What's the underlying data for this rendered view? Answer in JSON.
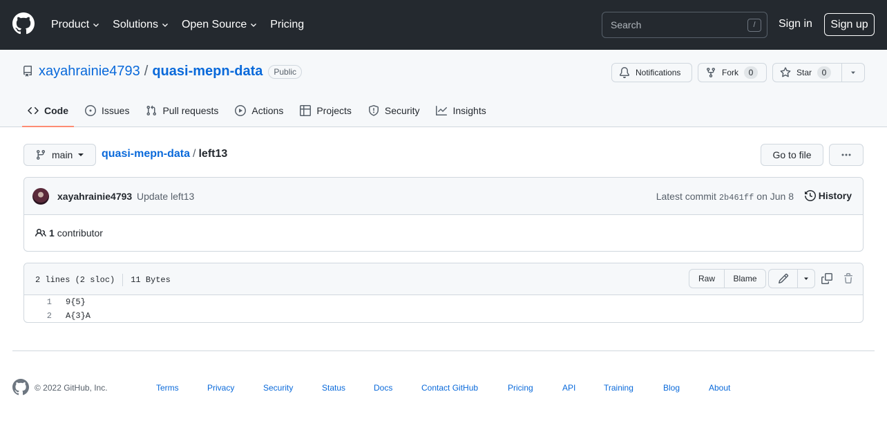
{
  "header": {
    "nav": [
      {
        "label": "Product",
        "dropdown": true
      },
      {
        "label": "Solutions",
        "dropdown": true
      },
      {
        "label": "Open Source",
        "dropdown": true
      },
      {
        "label": "Pricing",
        "dropdown": false
      }
    ],
    "search_placeholder": "Search",
    "search_shortcut": "/",
    "sign_in": "Sign in",
    "sign_up": "Sign up"
  },
  "repo": {
    "owner": "xayahrainie4793",
    "separator": "/",
    "name": "quasi-mepn-data",
    "visibility": "Public",
    "notifications_label": "Notifications",
    "fork_label": "Fork",
    "fork_count": "0",
    "star_label": "Star",
    "star_count": "0",
    "tabs": [
      {
        "label": "Code",
        "icon": "code-icon",
        "active": true
      },
      {
        "label": "Issues",
        "icon": "issue-icon",
        "active": false
      },
      {
        "label": "Pull requests",
        "icon": "pull-request-icon",
        "active": false
      },
      {
        "label": "Actions",
        "icon": "play-icon",
        "active": false
      },
      {
        "label": "Projects",
        "icon": "table-icon",
        "active": false
      },
      {
        "label": "Security",
        "icon": "shield-icon",
        "active": false
      },
      {
        "label": "Insights",
        "icon": "graph-icon",
        "active": false
      }
    ]
  },
  "file_nav": {
    "branch": "main",
    "breadcrumb_repo": "quasi-mepn-data",
    "breadcrumb_sep": "/",
    "breadcrumb_file": "left13",
    "go_to_file": "Go to file",
    "more_label": "···"
  },
  "commit": {
    "author": "xayahrainie4793",
    "message": "Update left13",
    "latest_label": "Latest commit",
    "sha": "2b461ff",
    "date": "on Jun 8",
    "history_label": "History",
    "contributors_count": "1",
    "contributors_label": "contributor"
  },
  "file": {
    "lines_info": "2 lines (2 sloc)",
    "size_info": "11 Bytes",
    "raw_label": "Raw",
    "blame_label": "Blame",
    "lines": [
      {
        "num": "1",
        "code": "9{5}"
      },
      {
        "num": "2",
        "code": "A{3}A"
      }
    ]
  },
  "footer": {
    "copyright": "© 2022 GitHub, Inc.",
    "links": [
      "Terms",
      "Privacy",
      "Security",
      "Status",
      "Docs",
      "Contact GitHub",
      "Pricing",
      "API",
      "Training",
      "Blog",
      "About"
    ]
  },
  "colors": {
    "header_bg": "#24292f",
    "link": "#0969da",
    "active_tab_underline": "#fd8c73",
    "subtle_bg": "#f6f8fa",
    "border": "#d0d7de"
  }
}
